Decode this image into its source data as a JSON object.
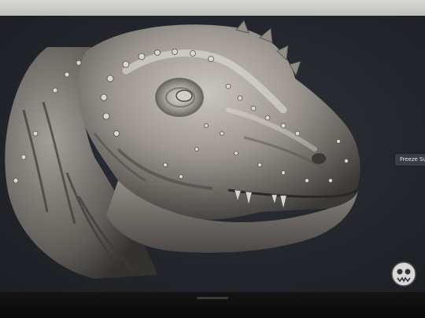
{
  "viewport": {
    "background": "#23262c",
    "model_color": "#8d8a86"
  },
  "tooltip": {
    "label": "Freeze Su"
  },
  "icons": {
    "mascot": "skull-face-icon"
  }
}
